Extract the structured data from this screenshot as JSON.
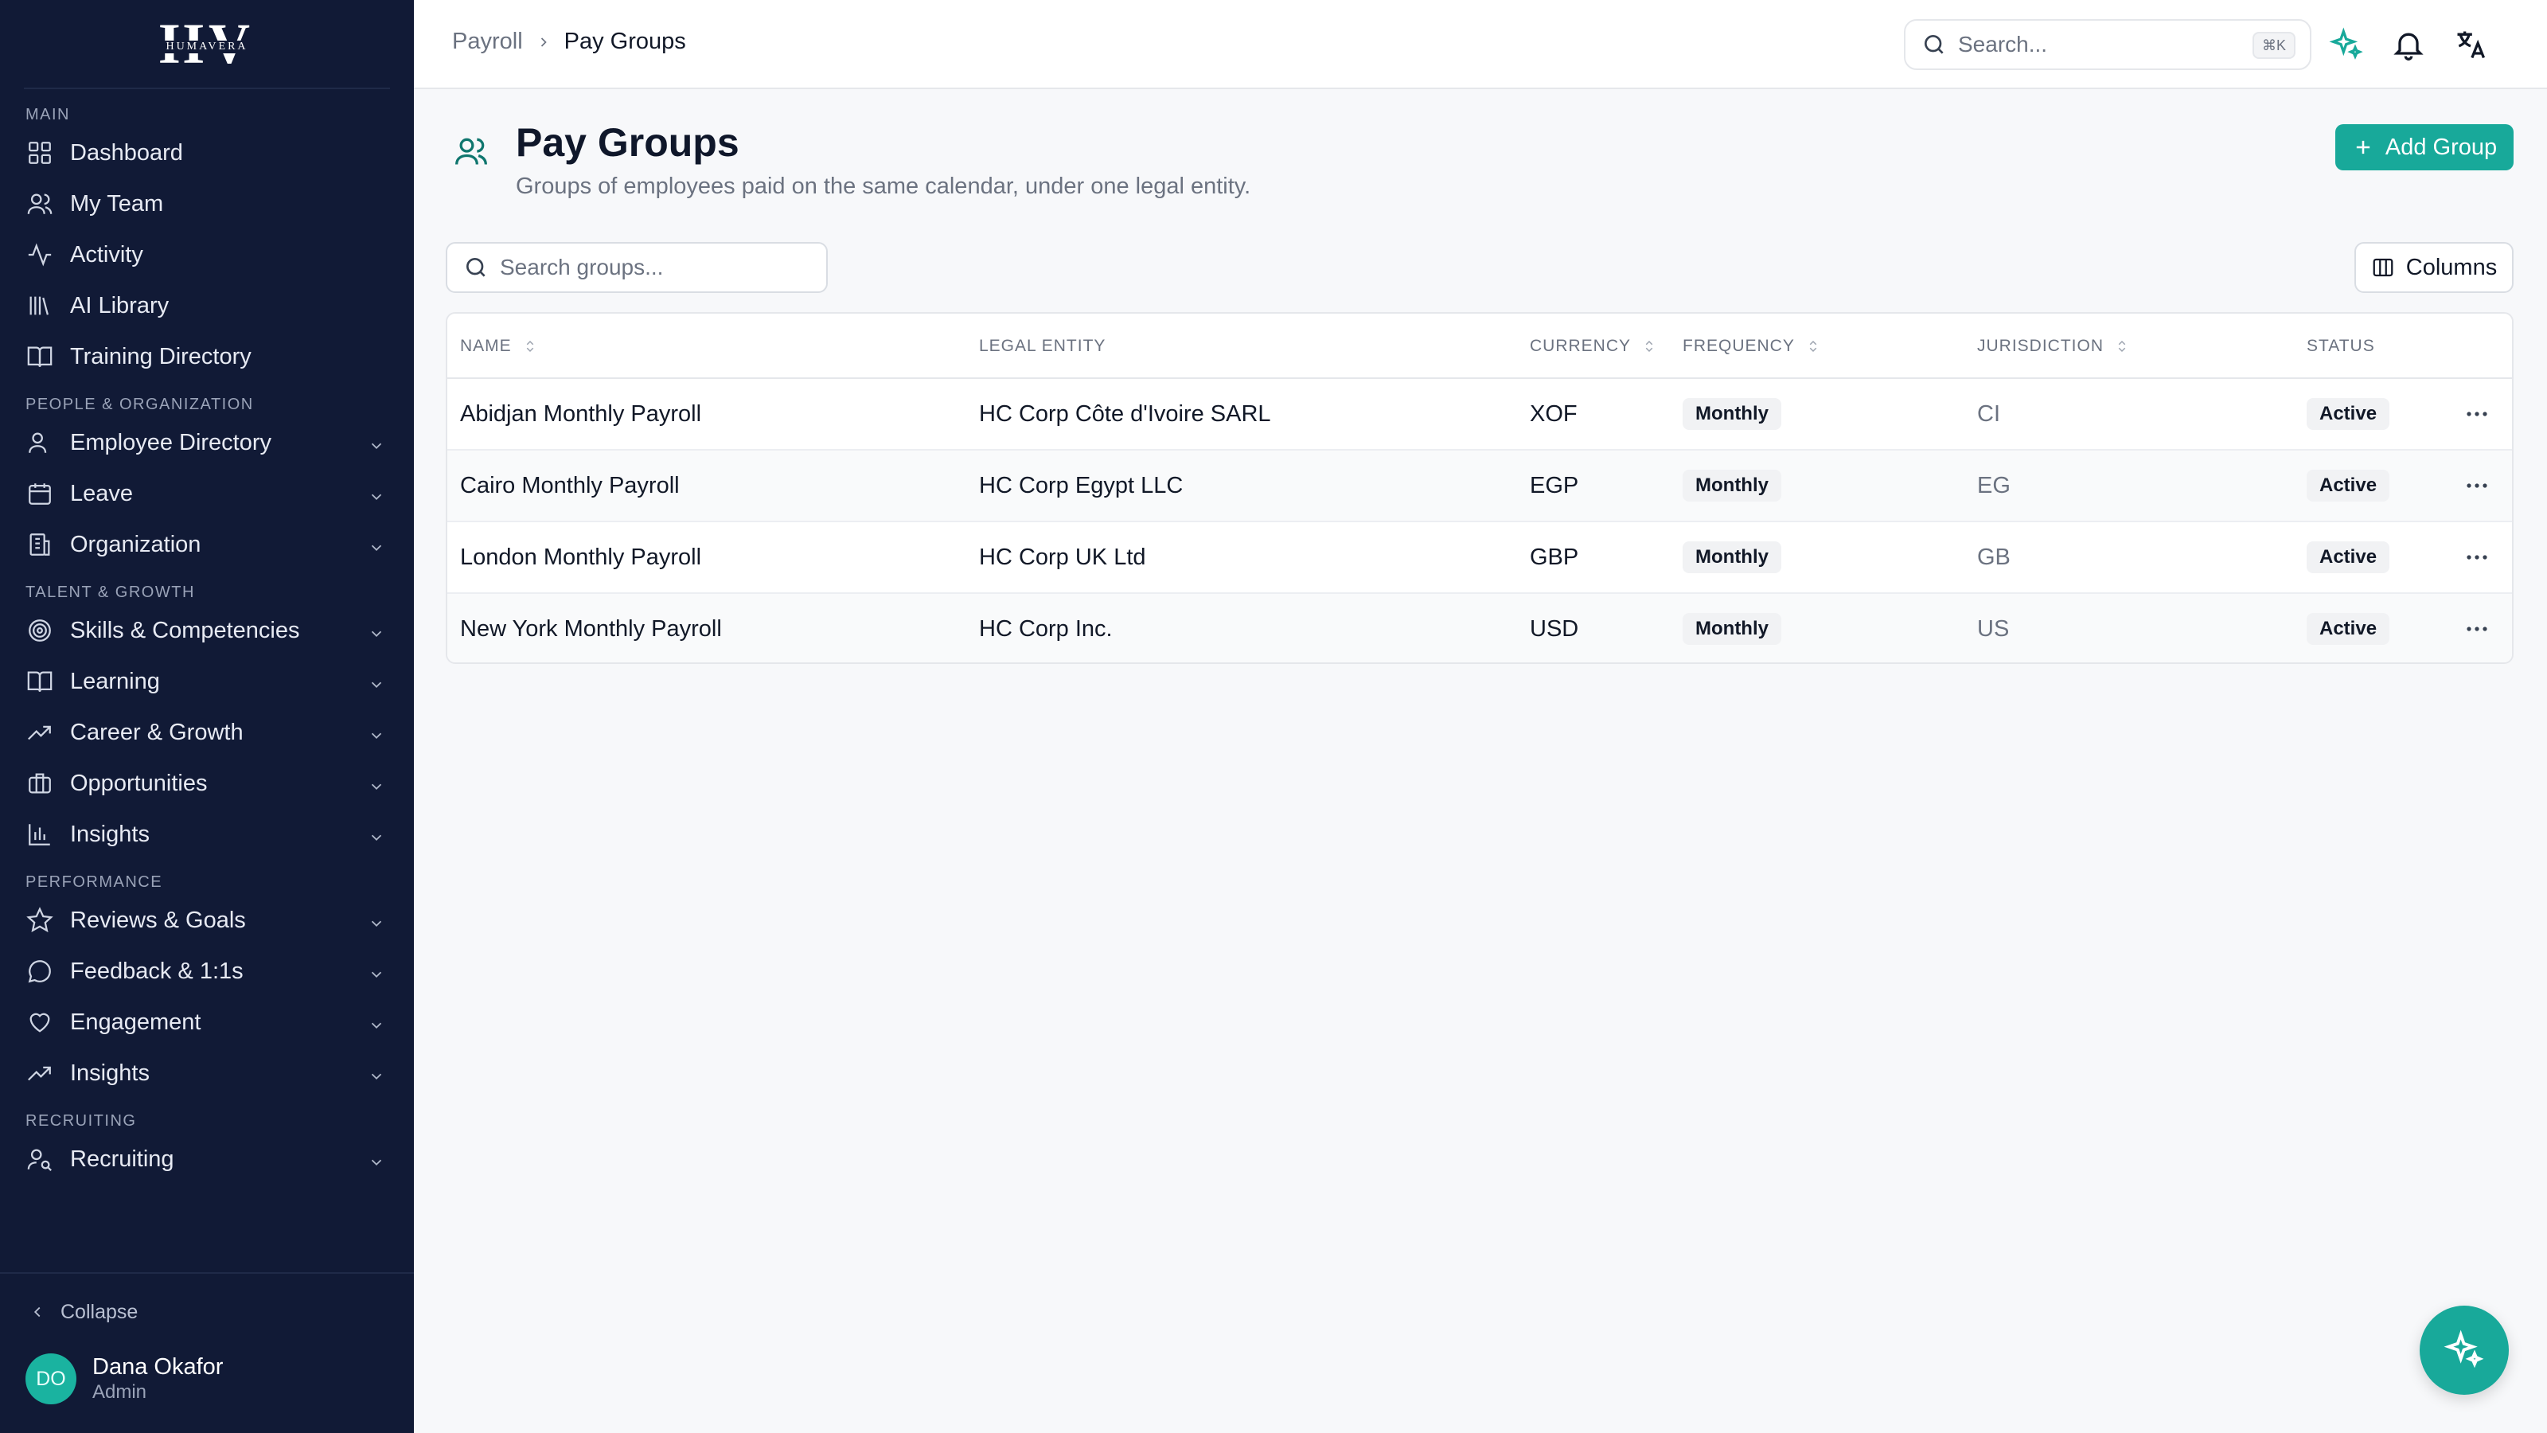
{
  "brand": {
    "logo_big": "HV",
    "logo_small": "HUMAVERA"
  },
  "colors": {
    "sidebar_bg": "#111a36",
    "accent": "#18a99a",
    "avatar": "#1ab3a0"
  },
  "sidebar": {
    "sections": [
      {
        "label": "MAIN",
        "items": [
          {
            "label": "Dashboard",
            "icon": "dashboard-icon",
            "expandable": false
          },
          {
            "label": "My Team",
            "icon": "users-icon",
            "expandable": false
          },
          {
            "label": "Activity",
            "icon": "activity-icon",
            "expandable": false
          },
          {
            "label": "AI Library",
            "icon": "library-icon",
            "expandable": false
          },
          {
            "label": "Training Directory",
            "icon": "book-open-icon",
            "expandable": false
          }
        ]
      },
      {
        "label": "PEOPLE & ORGANIZATION",
        "items": [
          {
            "label": "Employee Directory",
            "icon": "user-icon",
            "expandable": true
          },
          {
            "label": "Leave",
            "icon": "calendar-icon",
            "expandable": true
          },
          {
            "label": "Organization",
            "icon": "building-icon",
            "expandable": true
          }
        ]
      },
      {
        "label": "TALENT & GROWTH",
        "items": [
          {
            "label": "Skills & Competencies",
            "icon": "target-icon",
            "expandable": true
          },
          {
            "label": "Learning",
            "icon": "book-open-icon",
            "expandable": true
          },
          {
            "label": "Career & Growth",
            "icon": "trending-up-icon",
            "expandable": true
          },
          {
            "label": "Opportunities",
            "icon": "briefcase-icon",
            "expandable": true
          },
          {
            "label": "Insights",
            "icon": "bar-chart-icon",
            "expandable": true
          }
        ]
      },
      {
        "label": "PERFORMANCE",
        "items": [
          {
            "label": "Reviews & Goals",
            "icon": "star-icon",
            "expandable": true
          },
          {
            "label": "Feedback & 1:1s",
            "icon": "message-circle-icon",
            "expandable": true
          },
          {
            "label": "Engagement",
            "icon": "heart-icon",
            "expandable": true
          },
          {
            "label": "Insights",
            "icon": "trending-up-icon",
            "expandable": true
          }
        ]
      },
      {
        "label": "RECRUITING",
        "items": [
          {
            "label": "Recruiting",
            "icon": "user-search-icon",
            "expandable": true
          }
        ]
      }
    ],
    "collapse_label": "Collapse",
    "user": {
      "initials": "DO",
      "name": "Dana Okafor",
      "role": "Admin"
    }
  },
  "topbar": {
    "breadcrumb": {
      "parent": "Payroll",
      "current": "Pay Groups"
    },
    "search_placeholder": "Search...",
    "search_shortcut": "⌘K"
  },
  "page": {
    "title": "Pay Groups",
    "subtitle": "Groups of employees paid on the same calendar, under one legal entity.",
    "add_button": "Add Group",
    "groups_search_placeholder": "Search groups...",
    "columns_button": "Columns"
  },
  "table": {
    "columns": [
      {
        "label": "NAME",
        "sortable": true
      },
      {
        "label": "LEGAL ENTITY",
        "sortable": false
      },
      {
        "label": "CURRENCY",
        "sortable": true
      },
      {
        "label": "FREQUENCY",
        "sortable": true
      },
      {
        "label": "JURISDICTION",
        "sortable": true
      },
      {
        "label": "STATUS",
        "sortable": false
      }
    ],
    "rows": [
      {
        "name": "Abidjan Monthly Payroll",
        "legal_entity": "HC Corp Côte d'Ivoire SARL",
        "currency": "XOF",
        "frequency": "Monthly",
        "jurisdiction": "CI",
        "status": "Active"
      },
      {
        "name": "Cairo Monthly Payroll",
        "legal_entity": "HC Corp Egypt LLC",
        "currency": "EGP",
        "frequency": "Monthly",
        "jurisdiction": "EG",
        "status": "Active"
      },
      {
        "name": "London Monthly Payroll",
        "legal_entity": "HC Corp UK Ltd",
        "currency": "GBP",
        "frequency": "Monthly",
        "jurisdiction": "GB",
        "status": "Active"
      },
      {
        "name": "New York Monthly Payroll",
        "legal_entity": "HC Corp Inc.",
        "currency": "USD",
        "frequency": "Monthly",
        "jurisdiction": "US",
        "status": "Active"
      }
    ]
  }
}
